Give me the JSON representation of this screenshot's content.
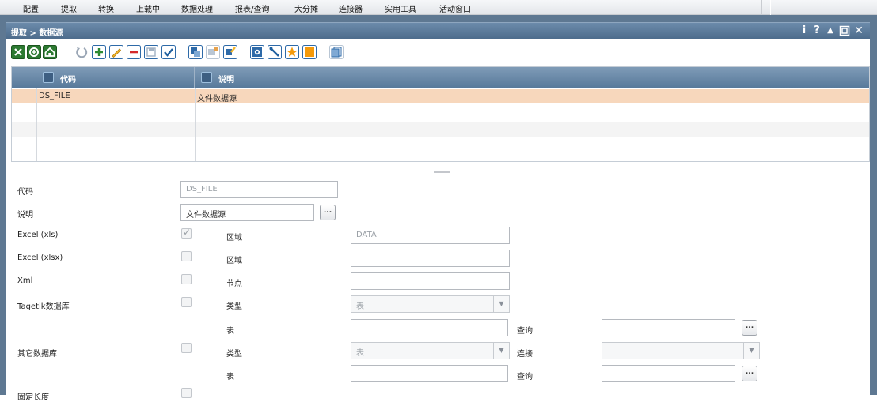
{
  "menu": [
    "配置",
    "提取",
    "转换",
    "上载中",
    "数据处理",
    "报表/查询",
    "大分摊",
    "连接器",
    "实用工具",
    "活动窗口"
  ],
  "window": {
    "title": "提取 > 数据源",
    "buttons": {
      "info": "i",
      "help": "?",
      "collapse": "▲",
      "maximize": "◻",
      "close": "✕"
    }
  },
  "toolbar": {
    "icons": [
      "excel-export-icon",
      "excel-import-icon",
      "home-icon",
      "refresh-icon",
      "add-icon",
      "edit-icon",
      "delete-icon",
      "save-icon",
      "confirm-icon",
      "copy-icon",
      "copy-plus-icon",
      "copy-edit-icon",
      "settings-icon",
      "tools-icon",
      "favorite-icon",
      "color-icon",
      "clone-icon"
    ]
  },
  "grid": {
    "columns": [
      "代码",
      "说明"
    ],
    "rows": [
      {
        "code": "DS_FILE",
        "desc": "文件数据源"
      }
    ]
  },
  "form": {
    "code_label": "代码",
    "code_value": "DS_FILE",
    "desc_label": "说明",
    "desc_value": "文件数据源",
    "dots": "...",
    "excel_xls_label": "Excel (xls)",
    "excel_xls_checked": true,
    "range_label": "区域",
    "excel_xls_range": "DATA",
    "excel_xlsx_label": "Excel (xlsx)",
    "excel_xlsx_checked": false,
    "xml_label": "Xml",
    "xml_checked": false,
    "node_label": "节点",
    "tagetik_label": "Tagetik数据库",
    "tagetik_checked": false,
    "type_label": "类型",
    "type_value": "表",
    "table_label": "表",
    "query_label": "查询",
    "other_db_label": "其它数据库",
    "other_db_checked": false,
    "connection_label": "连接",
    "fixed_length_label": "固定长度"
  }
}
